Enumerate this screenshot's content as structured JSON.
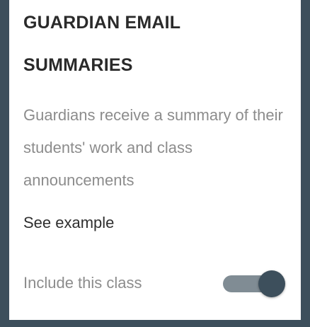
{
  "card": {
    "title": "GUARDIAN EMAIL SUMMARIES",
    "description": "Guardians receive a summary of their students' work and class announcements",
    "see_example_link": "See example",
    "include_label": "Include this class",
    "include_toggle_on": true
  },
  "colors": {
    "background": "#3d4f5c",
    "toggle_track": "#808c94",
    "toggle_thumb": "#3d4f5c"
  }
}
